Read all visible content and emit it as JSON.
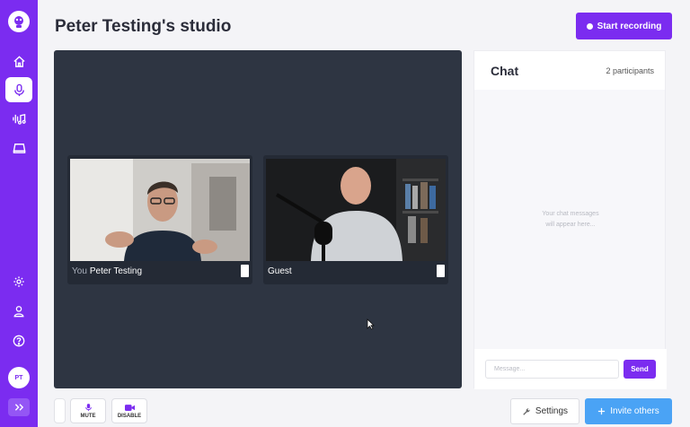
{
  "app": {
    "title": "Peter Testing's studio"
  },
  "sidebar": {
    "logo_icon": "podcast-mascot-icon",
    "items": [
      {
        "icon": "home-icon",
        "active": false
      },
      {
        "icon": "microphone-icon",
        "active": true
      },
      {
        "icon": "audio-wave-music-icon",
        "active": false
      },
      {
        "icon": "folder-tray-icon",
        "active": false
      }
    ],
    "bottom_items": [
      {
        "icon": "gear-icon"
      },
      {
        "icon": "user-icon"
      },
      {
        "icon": "help-circle-icon"
      }
    ],
    "avatar_initials": "PT",
    "expand_icon": "double-chevron-right-icon",
    "accent_color": "#7b2cf0"
  },
  "header": {
    "record_label": "Start recording"
  },
  "stage": {
    "participants": [
      {
        "prefix": "You",
        "name": "Peter Testing"
      },
      {
        "prefix": "",
        "name": "Guest"
      }
    ]
  },
  "chat": {
    "title": "Chat",
    "participant_count": "2 participants",
    "empty_line1": "Your chat messages",
    "empty_line2": "will appear here...",
    "input_placeholder": "Message...",
    "send_label": "Send"
  },
  "controls": {
    "mute_label": "MUTE",
    "disable_label": "DISABLE",
    "settings_label": "Settings",
    "invite_label": "Invite others",
    "invite_color": "#4aa3f5"
  }
}
